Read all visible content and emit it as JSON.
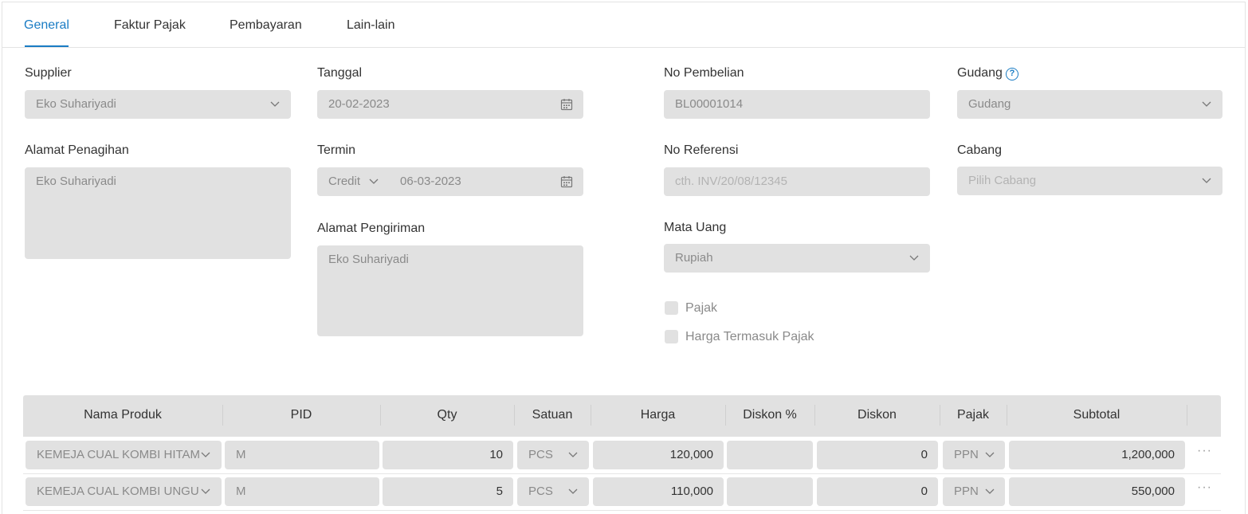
{
  "tabs": [
    {
      "label": "General",
      "active": true
    },
    {
      "label": "Faktur Pajak",
      "active": false
    },
    {
      "label": "Pembayaran",
      "active": false
    },
    {
      "label": "Lain-lain",
      "active": false
    }
  ],
  "form": {
    "supplier": {
      "label": "Supplier",
      "value": "Eko Suhariyadi"
    },
    "tanggal": {
      "label": "Tanggal",
      "value": "20-02-2023"
    },
    "no_pembelian": {
      "label": "No Pembelian",
      "value": "BL00001014"
    },
    "gudang": {
      "label": "Gudang",
      "value": "Gudang"
    },
    "alamat_penagihan": {
      "label": "Alamat Penagihan",
      "value": "Eko Suhariyadi"
    },
    "termin": {
      "label": "Termin",
      "type": "Credit",
      "date": "06-03-2023"
    },
    "no_referensi": {
      "label": "No Referensi",
      "placeholder": "cth. INV/20/08/12345"
    },
    "cabang": {
      "label": "Cabang",
      "placeholder": "Pilih Cabang"
    },
    "alamat_pengiriman": {
      "label": "Alamat Pengiriman",
      "value": "Eko Suhariyadi"
    },
    "mata_uang": {
      "label": "Mata Uang",
      "value": "Rupiah"
    },
    "pajak": {
      "label": "Pajak",
      "checked": false
    },
    "harga_termasuk_pajak": {
      "label": "Harga Termasuk Pajak",
      "checked": false
    }
  },
  "table": {
    "columns": [
      "Nama Produk",
      "PID",
      "Qty",
      "Satuan",
      "Harga",
      "Diskon %",
      "Diskon",
      "Pajak",
      "Subtotal"
    ],
    "rows": [
      {
        "produk": "KEMEJA CUAL KOMBI HITAM",
        "pid": "M",
        "qty": "10",
        "satuan": "PCS",
        "harga": "120,000",
        "diskon_pct": "",
        "diskon": "0",
        "pajak": "PPN",
        "subtotal": "1,200,000",
        "more": "···"
      },
      {
        "produk": "KEMEJA CUAL KOMBI UNGU",
        "pid": "M",
        "qty": "5",
        "satuan": "PCS",
        "harga": "110,000",
        "diskon_pct": "",
        "diskon": "0",
        "pajak": "PPN",
        "subtotal": "550,000",
        "more": "···"
      }
    ]
  },
  "colors": {
    "accent": "#1a7cc4",
    "field_bg": "#e1e1e1"
  }
}
